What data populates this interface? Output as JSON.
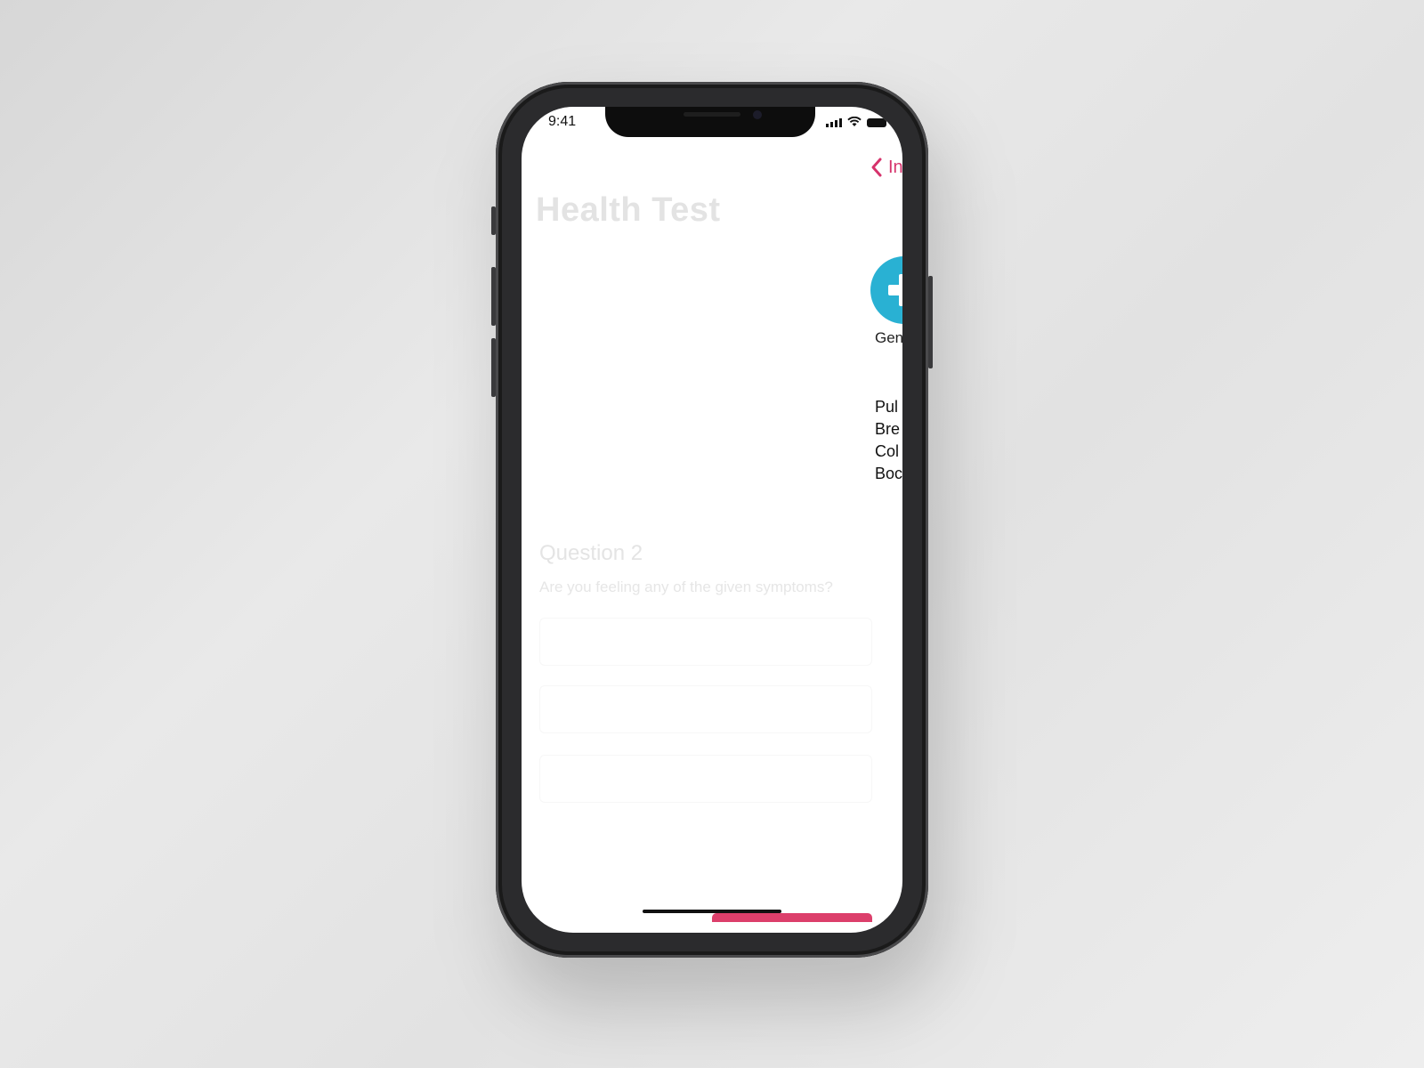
{
  "status_bar": {
    "time": "9:41"
  },
  "nav": {
    "back_label": "In"
  },
  "page": {
    "title": "Health Test"
  },
  "category": {
    "label": "Gen"
  },
  "symptom_list": [
    "Pul",
    "Bre",
    "Col",
    "Boc"
  ],
  "question": {
    "title": "Question 2",
    "text": "Are you feeling any of the given symptoms?"
  },
  "colors": {
    "accent": "#d6336c",
    "add_button": "#29b1d3",
    "progress": "#dc3f6b"
  },
  "icons": [
    "signal-icon",
    "wifi-icon",
    "battery-icon",
    "chevron-left-icon",
    "plus-icon"
  ]
}
